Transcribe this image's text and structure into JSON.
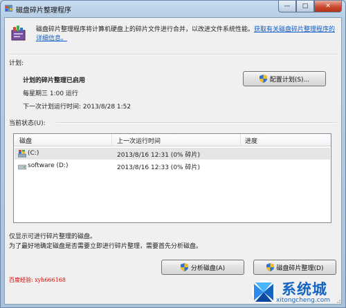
{
  "window": {
    "title": "磁盘碎片整理程序",
    "minimize": "—",
    "maximize": "□",
    "close": "✕"
  },
  "intro": {
    "text": "磁盘碎片整理程序将计算机硬盘上的碎片文件进行合并，以改进文件系统性能。",
    "link": "获取有关磁盘碎片整理程序的详细信息。"
  },
  "schedule": {
    "section_label": "计划:",
    "status": "计划的碎片整理已启用",
    "run_time": "每星期三  1:00 运行",
    "next_run": "下一次计划运行时间: 2013/8/28 1:52",
    "configure_button": "配置计划(S)..."
  },
  "current_status": {
    "section_label": "当前状态(U):",
    "columns": [
      "磁盘",
      "上一次运行时间",
      "进度"
    ],
    "rows": [
      {
        "disk": "(C:)",
        "last_run": "2013/8/16 12:31 (0% 碎片)",
        "progress": "",
        "icon": "system-drive-icon"
      },
      {
        "disk": "software (D:)",
        "last_run": "2013/8/16 12:33 (0% 碎片)",
        "progress": "",
        "icon": "drive-icon"
      }
    ]
  },
  "notes": {
    "line1": "仅显示可进行碎片整理的磁盘。",
    "line2": "为了最好地确定磁盘是否需要立即进行碎片整理，需要首先分析磁盘。"
  },
  "actions": {
    "analyze_button": "分析磁盘(A)",
    "defrag_button": "磁盘碎片整理(D)"
  },
  "watermark": "百度经验: xyh666168",
  "brand": {
    "name": "系统城",
    "url": "xitongcheng.com"
  },
  "colors": {
    "link": "#0b5cc9",
    "watermark": "#d40000",
    "brand": "#1565c0",
    "close_button": "#c8452a"
  }
}
